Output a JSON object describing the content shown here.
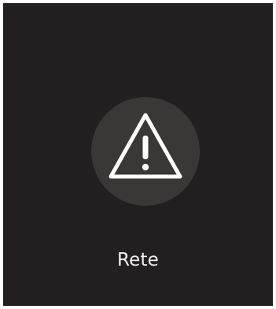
{
  "screen": {
    "icon": "warning-triangle-icon",
    "label": "Rete",
    "colors": {
      "background": "#231f20",
      "icon_circle": "#3a3737",
      "icon_stroke": "#ffffff",
      "text": "#f2f2f2"
    }
  }
}
